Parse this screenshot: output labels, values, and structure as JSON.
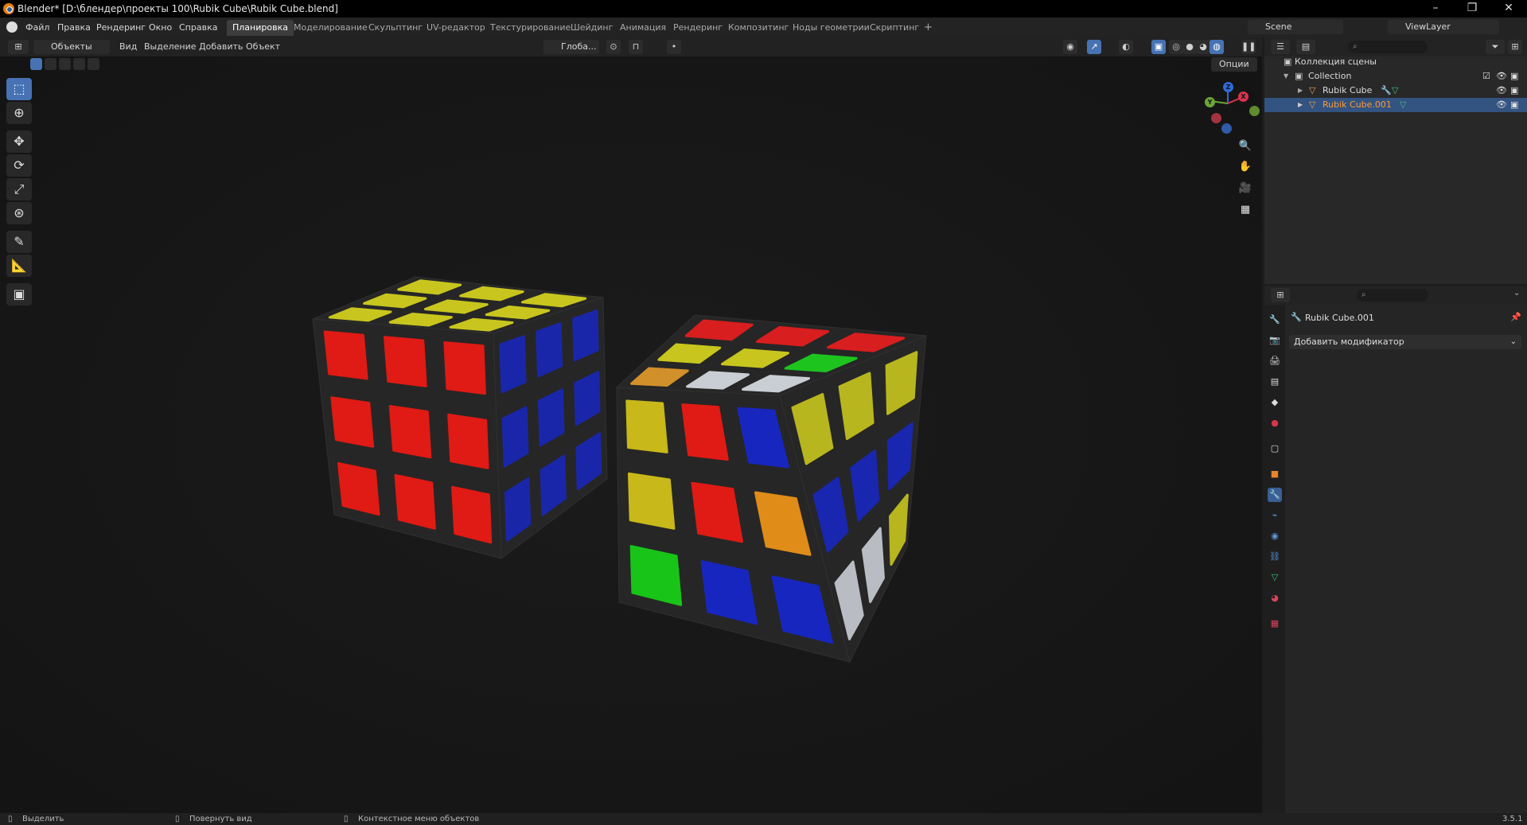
{
  "window": {
    "title": "Blender* [D:\\блендер\\проекты 100\\Rubik Cube\\Rubik Cube.blend]",
    "controls": [
      "–",
      "❐",
      "✕"
    ]
  },
  "menu": {
    "items": [
      "Файл",
      "Правка",
      "Рендеринг",
      "Окно",
      "Справка"
    ]
  },
  "workspaces": {
    "tabs": [
      "Планировка",
      "Моделирование",
      "Скульптинг",
      "UV-редактор",
      "Текстурирование",
      "Шейдинг",
      "Анимация",
      "Рендеринг",
      "Композитинг",
      "Ноды геометрии",
      "Скриптинг"
    ],
    "active_index": 0,
    "add_label": "+"
  },
  "scene": {
    "name": "Scene",
    "view_layer": "ViewLayer"
  },
  "viewport": {
    "mode": "Объекты",
    "menus": [
      "Вид",
      "Выделение",
      "Добавить",
      "Объект"
    ],
    "transform_orientation": "Глоба...",
    "options_label": "Опции",
    "gizmo_axes": {
      "z": "Z",
      "y": "Y",
      "x": "X"
    }
  },
  "outliner": {
    "root": "Коллекция сцены",
    "collection": "Collection",
    "objects": [
      {
        "name": "Rubik Cube",
        "selected": false
      },
      {
        "name": "Rubik Cube.001",
        "selected": true
      }
    ]
  },
  "properties": {
    "object_name": "Rubik Cube.001",
    "add_modifier": "Добавить модификатор"
  },
  "statusbar": {
    "select": "Выделить",
    "rotate": "Повернуть вид",
    "context": "Контекстное меню объектов",
    "version": "3.5.1"
  },
  "colors": {
    "accent": "#4772b3",
    "selected_row": "#335380",
    "selected_text": "#ff9b39",
    "viewport_bg": "#171717"
  },
  "cubes": {
    "cube1": {
      "top": [
        [
          "#c8c61e",
          "#c8c61e",
          "#c8c61e"
        ],
        [
          "#c8c61e",
          "#c8c61e",
          "#c8c61e"
        ],
        [
          "#c8c61e",
          "#c8c61e",
          "#c8c61e"
        ]
      ],
      "front": [
        [
          "#e01a14",
          "#e01a14",
          "#e01a14"
        ],
        [
          "#e01a14",
          "#e01a14",
          "#e01a14"
        ],
        [
          "#e01a14",
          "#e01a14",
          "#e01a14"
        ]
      ],
      "right": [
        [
          "#1826c0",
          "#1826c0",
          "#1826c0"
        ],
        [
          "#1826c0",
          "#1826c0",
          "#1826c0"
        ],
        [
          "#1826c0",
          "#1826c0",
          "#1826c0"
        ]
      ]
    },
    "cube2": {
      "top": [
        [
          "#d2902a",
          "#c8c61e",
          "#d81e1e"
        ],
        [
          "#c9cdd4",
          "#c8c61e",
          "#d81e1e"
        ],
        [
          "#c9cdd4",
          "#1ec41e",
          "#d81e1e"
        ]
      ],
      "front": [
        [
          "#c8b81a",
          "#e01a14",
          "#1826c0"
        ],
        [
          "#c8b81a",
          "#e01a14",
          "#e08c18"
        ],
        [
          "#18c418",
          "#1826c0",
          "#1826c0"
        ]
      ],
      "right": [
        [
          "#c8c61e",
          "#c8c61e",
          "#c8c61e"
        ],
        [
          "#1826c0",
          "#1826c0",
          "#1826c0"
        ],
        [
          "#c9cdd4",
          "#c9cdd4",
          "#c8c61e"
        ]
      ]
    }
  }
}
